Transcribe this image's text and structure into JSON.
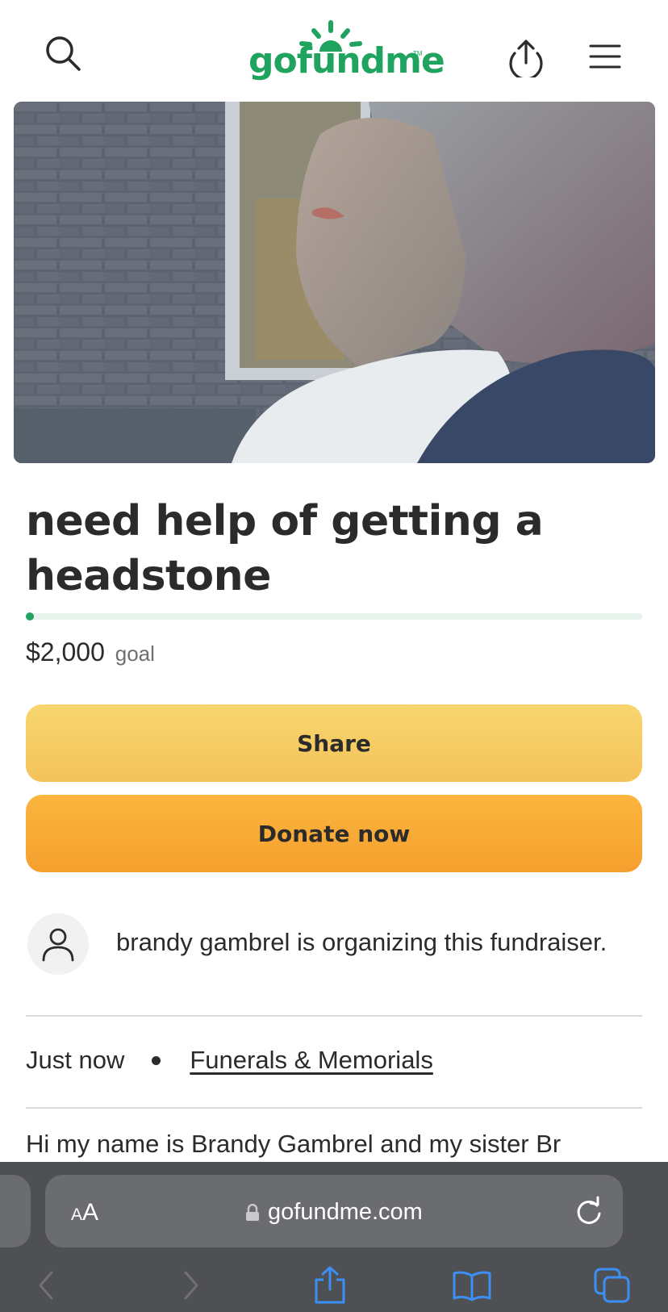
{
  "header": {
    "logo_text": "gofundme",
    "logo_tm": "TM"
  },
  "campaign": {
    "title": "need help of getting a headstone",
    "progress_fraction": 0.005,
    "goal_amount": "$2,000",
    "goal_label": "goal"
  },
  "actions": {
    "share_label": "Share",
    "donate_label": "Donate now"
  },
  "organizer": {
    "text": "brandy gambrel is organizing this fundraiser."
  },
  "meta": {
    "time": "Just now",
    "category": "Funerals & Memorials"
  },
  "story_peek": "Hi my name is Brandy Gambrel and my sister Br",
  "browser": {
    "aa_small": "A",
    "aa_large": "A",
    "url": "gofundme.com"
  },
  "colors": {
    "brand_green": "#1fa35f",
    "share_yellow": "#f6cb62",
    "donate_orange": "#f8a935",
    "safari_bar": "#4f5053",
    "toolbar_blue": "#3b8ff6"
  }
}
